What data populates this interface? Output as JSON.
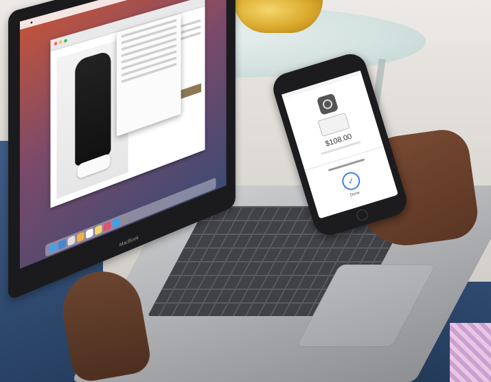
{
  "scene": {
    "description_hidden": ""
  },
  "laptop": {
    "menu_items": [
      "",
      "",
      "",
      ""
    ],
    "bezel_label": "MacBook"
  },
  "phone": {
    "amount": "$108.00",
    "done_label": "Done"
  },
  "colors": {
    "wallpaper_warm": "#c2543a",
    "wallpaper_cool": "#3e4a72",
    "accent_blue": "#3b7df0",
    "tan_button": "#8c7a55"
  }
}
